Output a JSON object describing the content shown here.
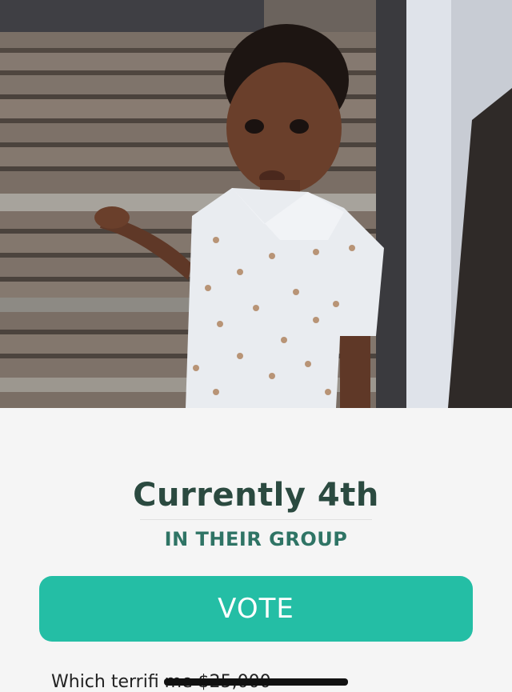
{
  "photo": {
    "subject": "toddler in bunny-print polo shirt"
  },
  "ranking": {
    "position_label": "Currently 4th",
    "group_label": "IN THEIR GROUP"
  },
  "vote_button": {
    "label": "VOTE"
  },
  "question": {
    "text": "Which terrifi                              me $25,000"
  },
  "colors": {
    "accent": "#24bea5",
    "title": "#2b4a40",
    "subtitle": "#2f7465",
    "background": "#f5f5f5"
  }
}
